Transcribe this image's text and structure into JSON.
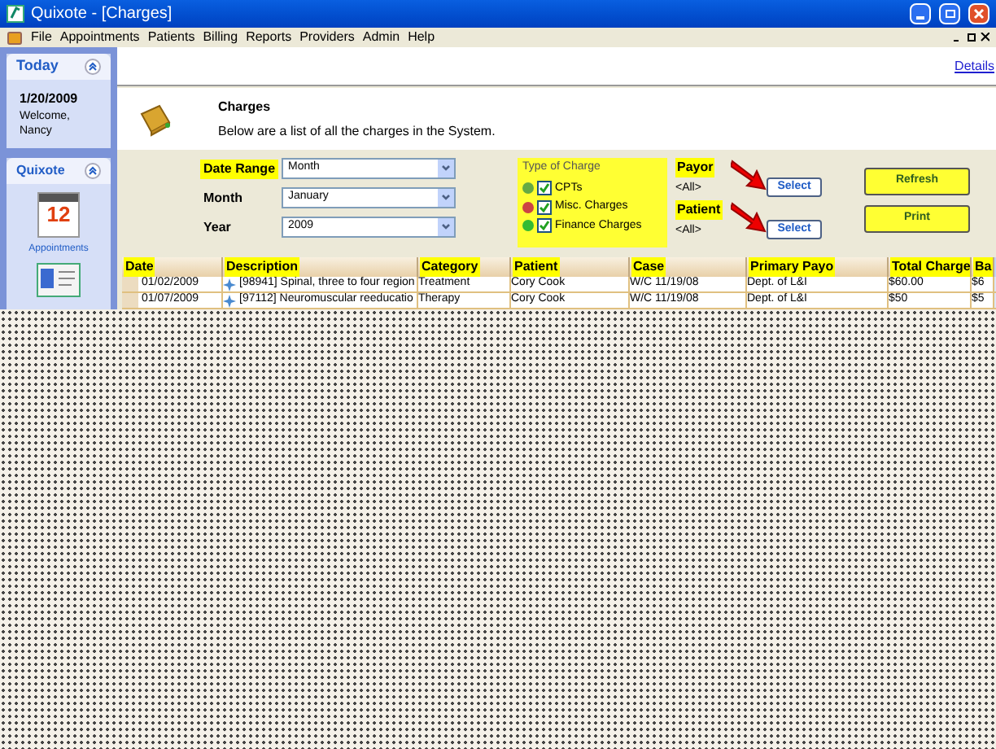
{
  "window": {
    "title": "Quixote - [Charges]"
  },
  "menu": [
    "File",
    "Appointments",
    "Patients",
    "Billing",
    "Reports",
    "Providers",
    "Admin",
    "Help"
  ],
  "sidebar": {
    "today": {
      "title": "Today",
      "date": "1/20/2009",
      "welcome": "Welcome, Nancy"
    },
    "quixote": {
      "title": "Quixote",
      "items": [
        {
          "kind": "calendar",
          "label": "Appointments",
          "calendar_day": "12"
        },
        {
          "kind": "card"
        }
      ]
    }
  },
  "details_link": "Details",
  "header": {
    "title": "Charges",
    "subtitle": "Below are a list of all the charges in the System."
  },
  "filters": {
    "date_range": {
      "label": "Date Range",
      "value": "Month"
    },
    "month": {
      "label": "Month",
      "value": "January"
    },
    "year": {
      "label": "Year",
      "value": "2009"
    }
  },
  "type_of_charge": {
    "title": "Type of Charge",
    "items": [
      {
        "label": "CPTs",
        "checked": true
      },
      {
        "label": "Misc. Charges",
        "checked": true
      },
      {
        "label": "Finance Charges",
        "checked": true
      }
    ]
  },
  "payor": {
    "label": "Payor",
    "value": "<All>",
    "button": "Select"
  },
  "patient": {
    "label": "Patient",
    "value": "<All>",
    "button": "Select"
  },
  "buttons": [
    "Refresh",
    "Print"
  ],
  "table": {
    "columns": [
      "Date",
      "Description",
      "Category",
      "Patient",
      "Case",
      "Primary Payo",
      "Total Charge",
      "Ba"
    ],
    "rows": [
      [
        "01/02/2009",
        "[98941] Spinal, three to four region",
        "Treatment",
        "Cory Cook",
        "W/C 11/19/08",
        "Dept. of L&I",
        "$60.00",
        "$6"
      ],
      [
        "01/07/2009",
        "[97112] Neuromuscular reeducatio",
        "Therapy",
        "Cory Cook",
        "W/C 11/19/08",
        "Dept. of L&I",
        "$50",
        "$5"
      ]
    ]
  }
}
